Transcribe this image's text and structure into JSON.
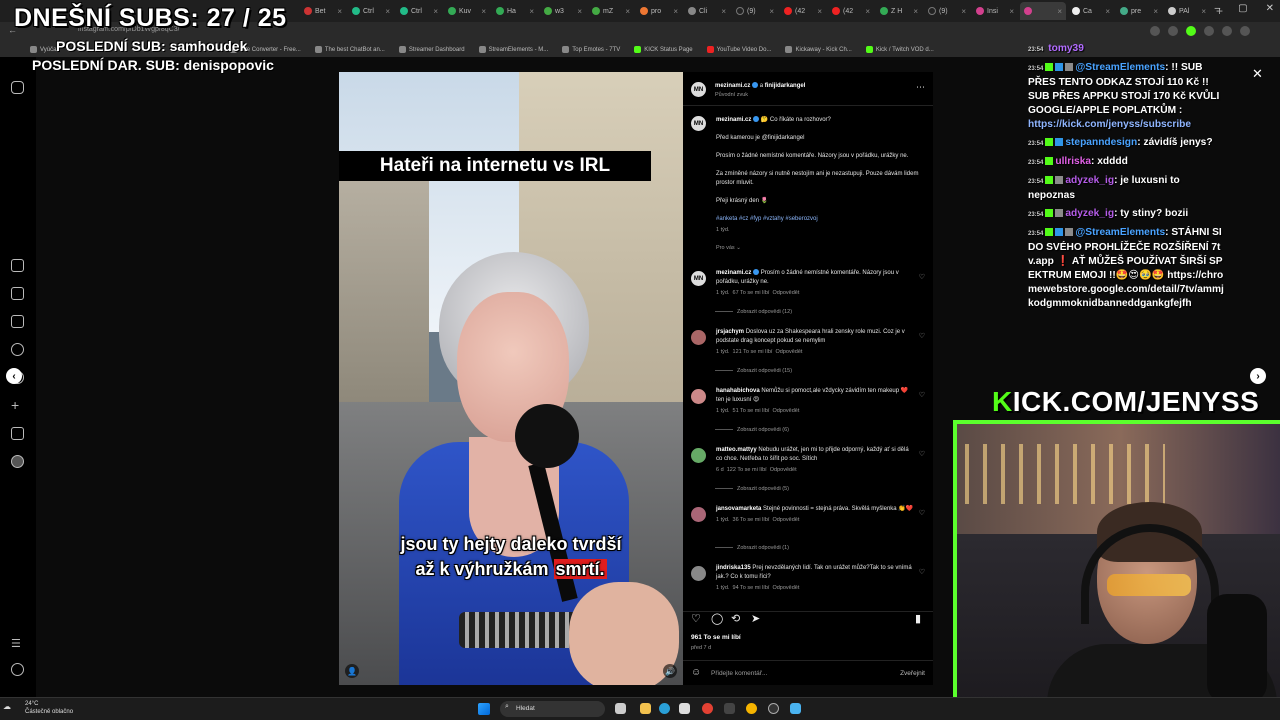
{
  "browser": {
    "tabs": [
      "Bet",
      "Ctrl",
      "Ctrl",
      "Kuv",
      "Ha",
      "w3",
      "mZ",
      "pro",
      "Cli",
      "(9)",
      "(42",
      "(42",
      "Z H",
      "(9)",
      "Insi",
      "",
      "Ca",
      "pre",
      "PAl"
    ],
    "url": "instagram.com/p/Db1Wgp/8qC3/",
    "bookmarks": [
      "Vyúča",
      "File Converter - Free...",
      "The best ChatBot an...",
      "Streamer Dashboard",
      "StreamElements - M...",
      "Top Emotes - 7TV",
      "KICK Status Page",
      "YouTube Video Do...",
      "Kickaway - Kick Ch...",
      "Kick / Twitch VOD d..."
    ]
  },
  "overlay": {
    "subs_today": "DNEŠNÍ SUBS: 27 / 25",
    "last_sub": "POSLEDNÍ SUB: samhoudek",
    "last_donation": "POSLEDNÍ DAR. SUB: denispopovic",
    "kick_url": "KICK.COM/JENYSS",
    "kick_k": "K",
    "kick_rest": "ICK.COM/JENYSS"
  },
  "video": {
    "title": "Hateři na internetu vs IRL",
    "caption_line1": "jsou ty hejty daleko tvrdší",
    "caption_line2_a": "až k výhružkám",
    "caption_line2_b": "smrtí."
  },
  "post": {
    "author": "mezinami.cz",
    "coauthor": "finijidarkangel",
    "audio": "Původní zvuk",
    "avatar_text": "MN",
    "caption_author": "mezinami.cz",
    "caption_head": "Co říkáte na rozhovor?",
    "caption_p1": "Před kamerou je @finijidarkangel",
    "caption_p2": "Prosím o žádné nemístné komentáře. Názory jsou v pořádku, urážky ne.",
    "caption_p3": "Za zmíněné názory si nutně nestojím ani je nezastupuji. Pouze dávám lidem prostor mluvit.",
    "caption_p4": "Přeji krásný den",
    "hashtags": "#anketa #cz #fyp #vztahy #seberozvoj",
    "caption_time": "1 týd.",
    "for_you": "Pro vás",
    "likes": "961 To se mi líbí",
    "posted": "před 7 d",
    "add_comment_placeholder": "Přidejte komentář...",
    "publish": "Zveřejnit"
  },
  "comments": [
    {
      "user": "mezinami.cz",
      "text": "Prosím o žádné nemístné komentáře. Názory jsou v pořádku, urážky ne.",
      "time": "1 týd.",
      "likes": "67 To se mi líbí",
      "reply": "Odpovědět",
      "view": "Zobrazit odpovědi (12)"
    },
    {
      "user": "jrsjachym",
      "text": "Doslova uz za Shakespeara hrali zensky role muzi. Coz je v podstate drag koncept pokud se nemylim",
      "time": "1 týd.",
      "likes": "121 To se mi líbí",
      "reply": "Odpovědět",
      "view": "Zobrazit odpovědi (15)"
    },
    {
      "user": "hanahabichova",
      "text": "Nemůžu si pomoct,ale vždycky závidím ten makeup ❤️ ten je luxusní 😍",
      "time": "1 týd.",
      "likes": "51 To se mi líbí",
      "reply": "Odpovědět",
      "view": "Zobrazit odpovědi (6)"
    },
    {
      "user": "matteo.mattyy",
      "text": "Nebudu urážet, jen mi to přijde odporný, každý ať si dělá co chce. Netřeba to šířit po soc. Sítích",
      "time": "6 d",
      "likes": "122 To se mi líbí",
      "reply": "Odpovědět",
      "view": "Zobrazit odpovědi (5)"
    },
    {
      "user": "jansovamarketa",
      "text": "Stejné povinnosti = stejná práva. Skvělá myšlenka 👏❤️",
      "time": "1 týd.",
      "likes": "36 To se mi líbí",
      "reply": "Odpovědět",
      "view": "Zobrazit odpovědi (1)"
    },
    {
      "user": "jindriska135",
      "text": "Prej nevzdělaných lidí. Tak on urážet může?Tak to se vnímá jak.? Co k tomu říci?",
      "time": "1 týd.",
      "likes": "94 To se mi líbí",
      "reply": "Odpovědět",
      "view": ""
    }
  ],
  "chat": [
    {
      "ts": "23:54",
      "user": "tomy39",
      "text": ""
    },
    {
      "ts": "23:54",
      "user": "@StreamElements",
      "text": ": !! SUB PŘES TENTO ODKAZ STOJÍ 110 Kč !! SUB PŘES APPKU STOJÍ 170 Kč KVŮLI GOOGLE/APPLE POPLATKŮM :",
      "link": "https://kick.com/jenyss/subscribe"
    },
    {
      "ts": "23:54",
      "user": "stepanndesign",
      "text": ": závidíš jenys?"
    },
    {
      "ts": "23:54",
      "user": "ullriska",
      "text": ": xdddd"
    },
    {
      "ts": "23:54",
      "user": "adyzek_ig",
      "text": ": je luxusni to nepoznas"
    },
    {
      "ts": "23:54",
      "user": "adyzek_ig",
      "text": ": ty stiny? bozii"
    },
    {
      "ts": "23:54",
      "user": "@StreamElements",
      "text": ": STÁHNI SI DO SVÉHO PROHLÍŽEČE ROZŠÍŘENÍ 7tv.app ❗ AŤ MŮŽEŠ POUŽÍVAT ŠIRŠÍ SPEKTRUM EMOJI !!🤩😍🥹🤩 https://chromewebstore.google.com/detail/7tv/ammjkodgmmoknidbanneddgankgfejfh"
    }
  ],
  "taskbar": {
    "temp": "24°C",
    "weather": "Částečně oblačno",
    "search": "Hledat"
  },
  "colors": {
    "kick_green": "#53fc18",
    "ig_blue": "#3897f0",
    "caption_red": "#e01d1d"
  }
}
